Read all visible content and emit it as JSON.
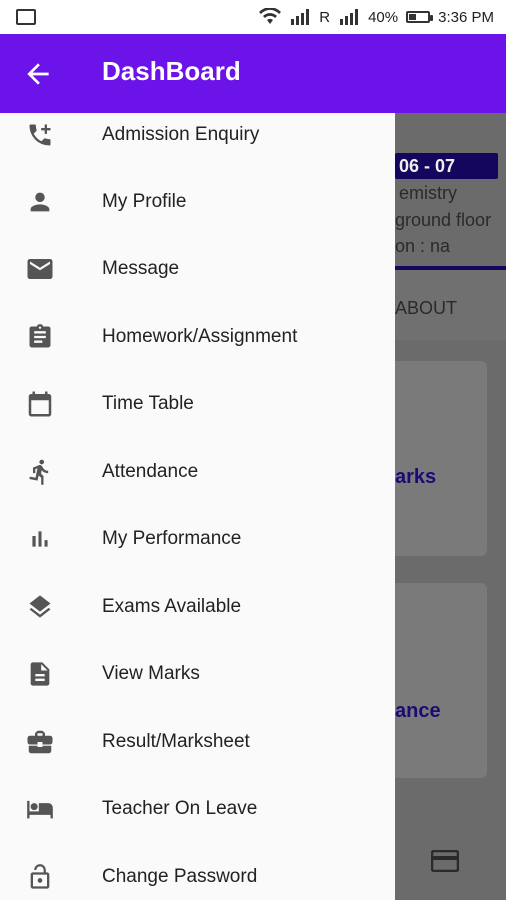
{
  "status_bar": {
    "carrier_r": "R",
    "battery_percent": "40%",
    "battery_level": 0.4,
    "time": "3:36 PM"
  },
  "app_bar": {
    "title": "DashBoard"
  },
  "background": {
    "date_chip": "06 - 07",
    "line1": "emistry",
    "line2": "ground floor",
    "line3": "on : na",
    "tab_about": "ABOUT",
    "card1_label": "arks",
    "card2_label": "ance"
  },
  "drawer": {
    "items": [
      {
        "label": "Admission Enquiry",
        "icon": "phone-add-icon"
      },
      {
        "label": "My Profile",
        "icon": "person-icon"
      },
      {
        "label": "Message",
        "icon": "mail-icon"
      },
      {
        "label": "Homework/Assignment",
        "icon": "clipboard-icon"
      },
      {
        "label": "Time Table",
        "icon": "calendar-icon"
      },
      {
        "label": "Attendance",
        "icon": "running-person-icon"
      },
      {
        "label": "My Performance",
        "icon": "bar-chart-icon"
      },
      {
        "label": "Exams Available",
        "icon": "layers-icon"
      },
      {
        "label": "View Marks",
        "icon": "document-icon"
      },
      {
        "label": "Result/Marksheet",
        "icon": "briefcase-icon"
      },
      {
        "label": "Teacher On Leave",
        "icon": "bed-icon"
      },
      {
        "label": "Change Password",
        "icon": "lock-open-icon"
      }
    ]
  }
}
